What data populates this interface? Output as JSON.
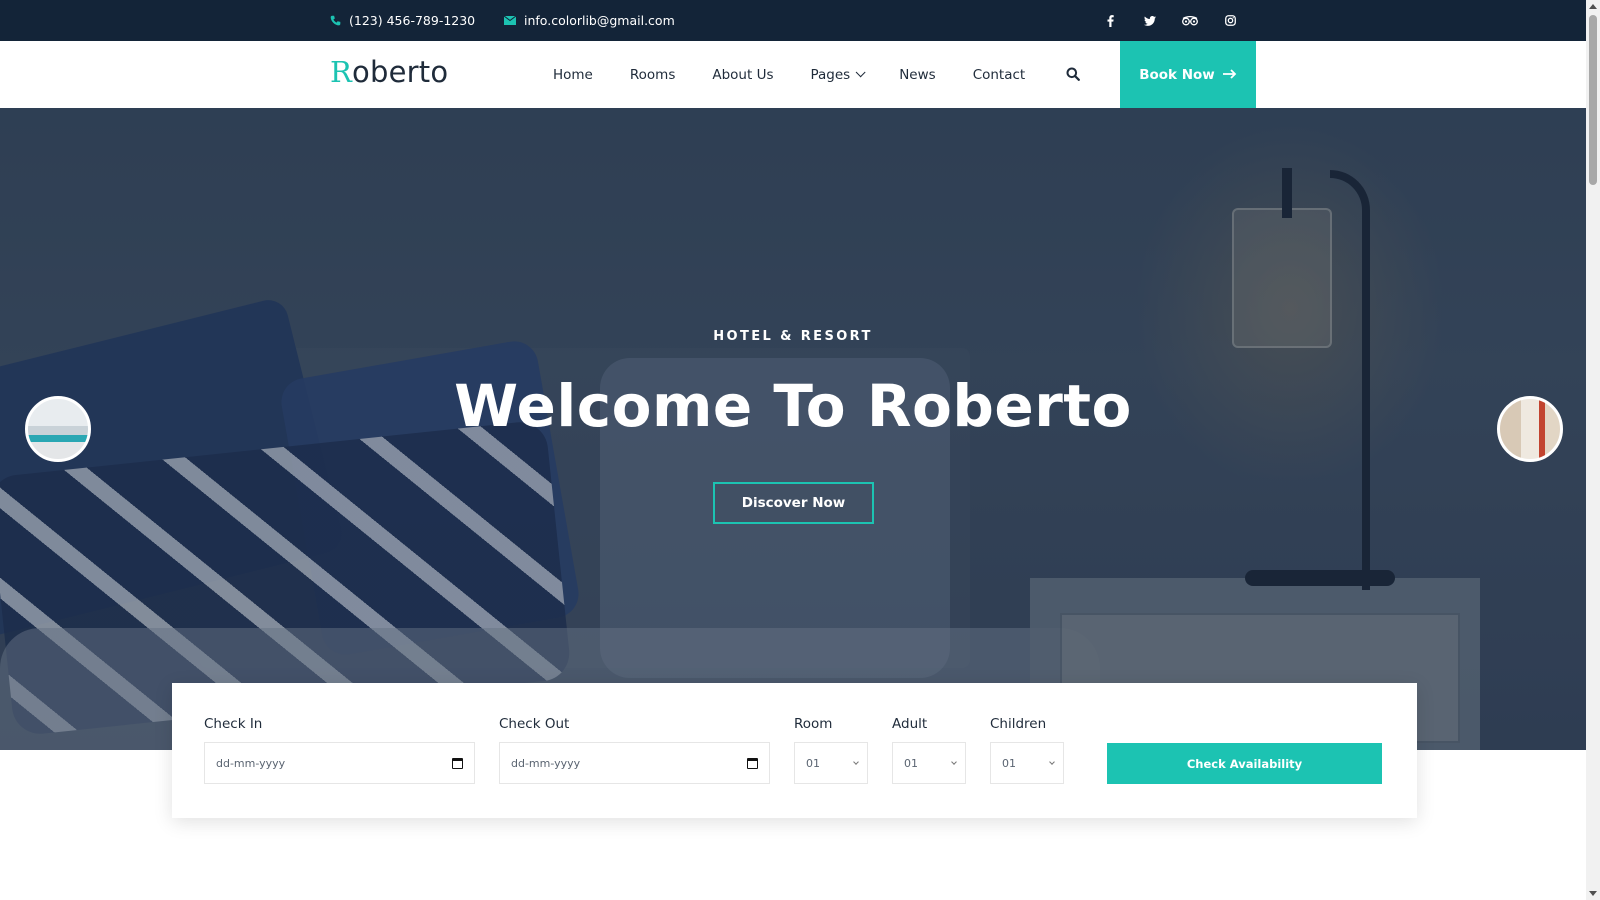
{
  "topbar": {
    "phone": "(123) 456-789-1230",
    "email": "info.colorlib@gmail.com",
    "socials": [
      {
        "icon": "facebook-icon",
        "glyph": "f"
      },
      {
        "icon": "twitter-icon",
        "glyph": "t"
      },
      {
        "icon": "tripadvisor-icon",
        "glyph": "oo"
      },
      {
        "icon": "instagram-icon",
        "glyph": "◎"
      }
    ]
  },
  "header": {
    "logo_initial": "R",
    "logo_rest": "oberto",
    "nav": [
      "Home",
      "Rooms",
      "About Us",
      "Pages",
      "News",
      "Contact"
    ],
    "book_label": "Book Now"
  },
  "hero": {
    "subtitle": "HOTEL & RESORT",
    "title": "Welcome To Roberto",
    "cta": "Discover Now"
  },
  "booking": {
    "check_in_label": "Check In",
    "check_in_placeholder": "dd-mm-yyyy",
    "check_out_label": "Check Out",
    "check_out_placeholder": "dd-mm-yyyy",
    "room_label": "Room",
    "room_value": "01",
    "adult_label": "Adult",
    "adult_value": "01",
    "children_label": "Children",
    "children_value": "01",
    "submit_label": "Check Availability"
  },
  "colors": {
    "accent": "#1cc3b2",
    "topbar_bg": "#132438",
    "text": "#1f2b3a"
  }
}
